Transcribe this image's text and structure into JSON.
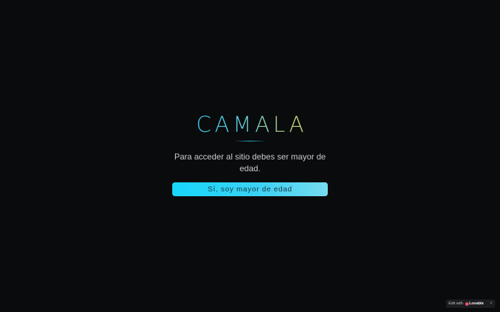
{
  "brand": {
    "title": "CAMALA"
  },
  "age_gate": {
    "message": "Para acceder al sitio debes ser mayor de edad.",
    "confirm_label": "Sí, soy mayor de edad"
  },
  "lovable_badge": {
    "prefix": "Edit with",
    "brand": "Lovable",
    "close": "×",
    "icon": "lovable-heart-icon"
  },
  "colors": {
    "background": "#0a0b0d",
    "accent_cyan": "#16d7fa",
    "accent_yellow": "#d6d46c",
    "text_muted": "#c9ccd1"
  }
}
